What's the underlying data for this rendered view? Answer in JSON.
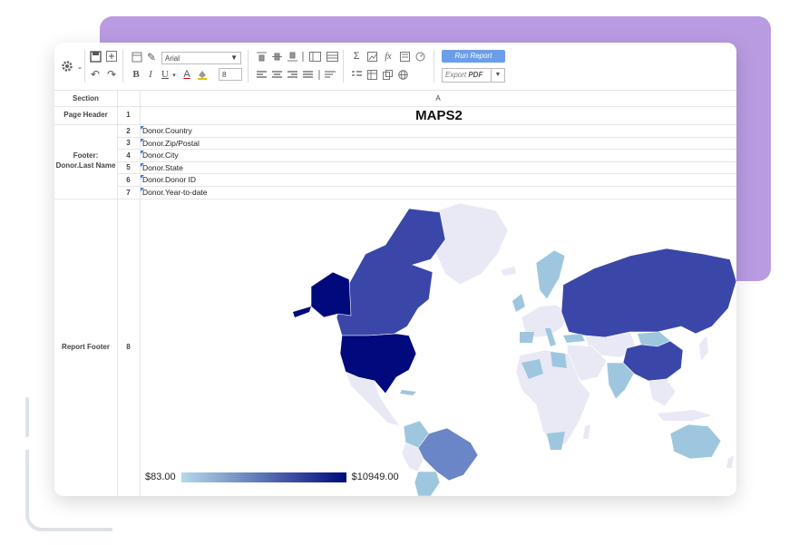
{
  "toolbar": {
    "font_name": "Arial",
    "font_size": "8",
    "run_report_label": "Run Report",
    "export_label_prefix": "Export ",
    "export_label_format": "PDF",
    "bold_label": "B",
    "italic_label": "I",
    "underline_label": "U",
    "font_color_label": "A",
    "sum_label": "Σ",
    "fx_label": "fx"
  },
  "grid": {
    "section_header": "Section",
    "column_a_header": "A",
    "sections": {
      "page_header": "Page Header",
      "footer_line1": "Footer:",
      "footer_line2": "Donor.Last Name",
      "report_footer": "Report Footer"
    },
    "row_numbers": [
      "1",
      "2",
      "3",
      "4",
      "5",
      "6",
      "7",
      "8"
    ],
    "title": "MAPS2",
    "fields": [
      "Donor.Country",
      "Donor.Zip/Postal",
      "Donor.City",
      "Donor.State",
      "Donor.Donor ID",
      "Donor.Year-to-date"
    ]
  },
  "map": {
    "legend_min": "$83.00",
    "legend_max": "$10949.00",
    "colors": {
      "darkest": "#000a7d",
      "dark": "#3a47a8",
      "mid": "#6b86c6",
      "light": "#9ec7df",
      "lightest": "#e9e9f6",
      "brand_purple": "#b99be2",
      "run_button": "#6a9ee8"
    }
  }
}
